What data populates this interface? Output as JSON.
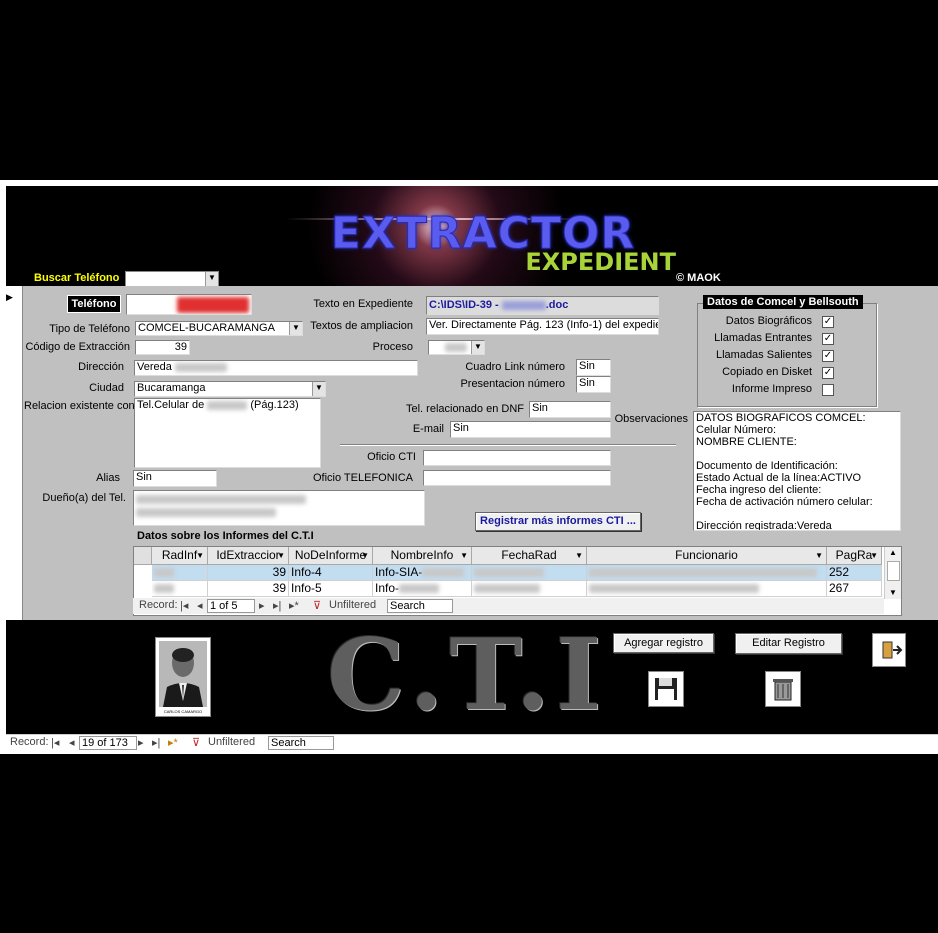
{
  "header": {
    "logo_main": "EXTRACTOR",
    "logo_sub": "EXPEDIENT",
    "copyright": "© MAOK",
    "search_label": "Buscar Teléfono",
    "search_value": ""
  },
  "form": {
    "telefono_label": "Teléfono",
    "telefono_value": "",
    "tipo_label": "Tipo de Teléfono",
    "tipo_value": "COMCEL-BUCARAMANGA",
    "codigo_label": "Código de Extracción",
    "codigo_value": "39",
    "direccion_label": "Dirección",
    "direccion_value": "Vereda",
    "ciudad_label": "Ciudad",
    "ciudad_value": "Bucaramanga",
    "relacion_label": "Relacion existente con:",
    "relacion_prefix": "Tel.Celular de",
    "relacion_suffix": "(Pág.123)",
    "alias_label": "Alias",
    "alias_value": "Sin",
    "dueno_label": "Dueño(a) del Tel.",
    "texto_exp_label": "Texto en Expediente",
    "texto_exp_prefix": "C:\\IDS\\ID-39 -",
    "texto_exp_suffix": ".doc",
    "ampliacion_label": "Textos de ampliacion",
    "ampliacion_value": "Ver. Directamente Pág. 123 (Info-1) del expedient",
    "proceso_label": "Proceso",
    "cuadro_label": "Cuadro Link número",
    "cuadro_value": "Sin",
    "presentacion_label": "Presentacion número",
    "presentacion_value": "Sin",
    "dnf_label": "Tel. relacionado en DNF",
    "dnf_value": "Sin",
    "email_label": "E-mail",
    "email_value": "Sin",
    "oficio_cti_label": "Oficio CTI",
    "oficio_tel_label": "Oficio TELEFONICA",
    "observaciones_label": "Observaciones",
    "observaciones_lines": [
      "DATOS BIOGRAFICOS COMCEL:",
      "Celular Número:",
      "NOMBRE  CLIENTE:",
      "",
      "Documento de Identificación:",
      "Estado Actual de la línea:ACTIVO",
      "Fecha ingreso del cliente:",
      "Fecha de activación número celular:",
      "",
      "Dirección registrada:Vereda"
    ],
    "registrar_button": "Registrar más informes CTI ..."
  },
  "datos_group": {
    "title": "Datos de Comcel y Bellsouth",
    "items": [
      {
        "label": "Datos Biográficos",
        "checked": true
      },
      {
        "label": "Llamadas Entrantes",
        "checked": true
      },
      {
        "label": "Llamadas Salientes",
        "checked": true
      },
      {
        "label": "Copiado en Disket",
        "checked": true
      },
      {
        "label": "Informe Impreso",
        "checked": false
      }
    ]
  },
  "informes": {
    "title": "Datos sobre los Informes del C.T.I",
    "columns": [
      "RadInf",
      "IdExtraccior",
      "NoDeInforme",
      "NombreInfo",
      "FechaRad",
      "Funcionario",
      "PagRa"
    ],
    "rows": [
      {
        "id_extraccion": "39",
        "no_informe": "Info-4",
        "nombre_info": "Info-SIA-",
        "pag": "252"
      },
      {
        "id_extraccion": "39",
        "no_informe": "Info-5",
        "nombre_info": "Info-",
        "pag": "267"
      }
    ],
    "nav": {
      "record_label": "Record:",
      "position": "1 of 5",
      "filter": "Unfiltered",
      "search": "Search"
    }
  },
  "footer": {
    "cti_text": "C.T.I",
    "photo_caption": "CARLOS CAMARGO",
    "agregar_button": "Agregar registro",
    "editar_button": "Editar Registro"
  },
  "statusbar": {
    "record_label": "Record:",
    "position": "19 of 173",
    "filter": "Unfiltered",
    "search": "Search"
  }
}
